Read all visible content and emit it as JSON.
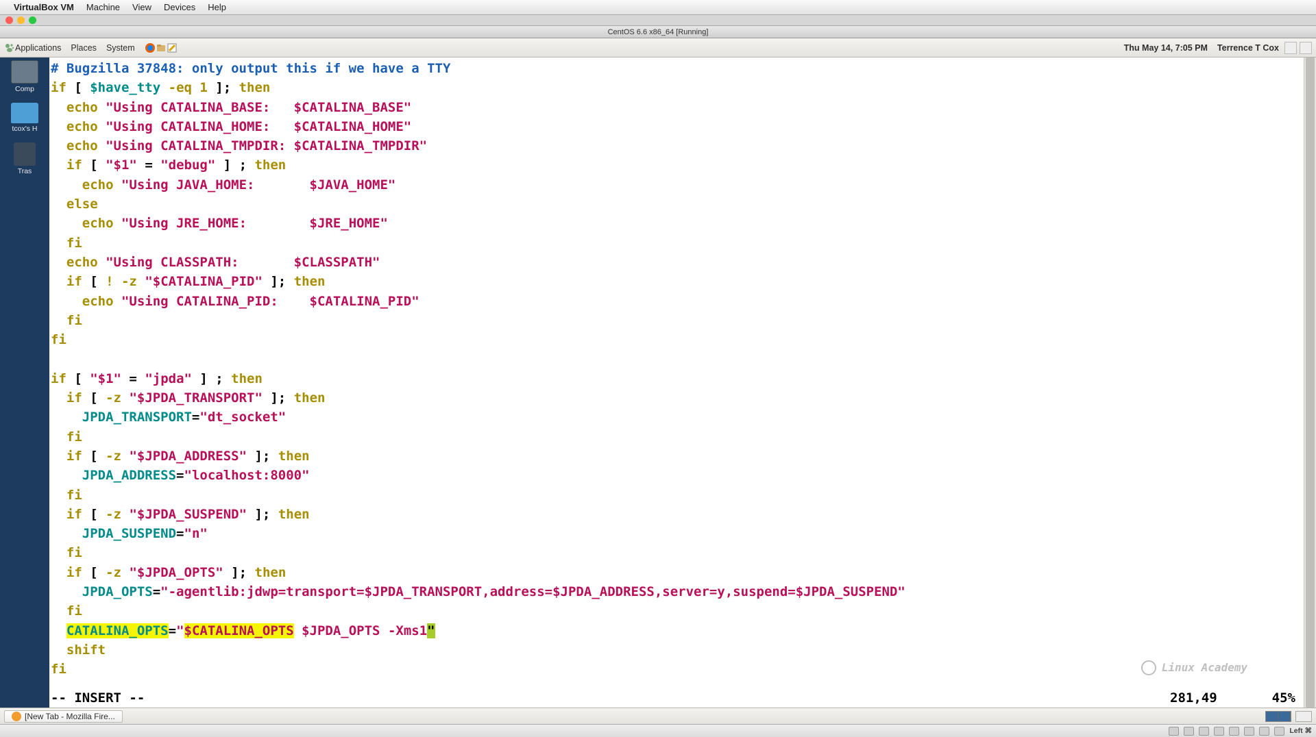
{
  "mac_menu": {
    "app": "VirtualBox VM",
    "items": [
      "Machine",
      "View",
      "Devices",
      "Help"
    ]
  },
  "vm_title": "CentOS 6.6 x86_64 [Running]",
  "gnome_top": {
    "menus": [
      "Applications",
      "Places",
      "System"
    ],
    "clock": "Thu May 14,  7:05 PM",
    "user": "Terrence T Cox"
  },
  "desktop_icons": {
    "computer": "Comp",
    "home": "tcox's H",
    "trash": "Tras"
  },
  "task_button": "[New Tab - Mozilla Fire...",
  "vb_hostkey": "Left ⌘",
  "watermark": "Linux Academy",
  "vim": {
    "mode": "-- INSERT --",
    "pos": "281,49",
    "pct": "45%",
    "code": {
      "l1_comment": "# Bugzilla 37848: only output this if we have a TTY",
      "have_tty": "$have_tty",
      "eq1": "-eq 1",
      "echo": "echo",
      "if": "if",
      "then": "then",
      "else": "else",
      "fi": "fi",
      "shift": "shift",
      "using_cb": "\"Using CATALINA_BASE:   $CATALINA_BASE\"",
      "using_ch": "\"Using CATALINA_HOME:   $CATALINA_HOME\"",
      "using_ct": "\"Using CATALINA_TMPDIR: $CATALINA_TMPDIR\"",
      "q1": "\"$1\"",
      "debug": "\"debug\"",
      "using_jh": "\"Using JAVA_HOME:       $JAVA_HOME\"",
      "using_jre": "\"Using JRE_HOME:        $JRE_HOME\"",
      "using_cp": "\"Using CLASSPATH:       $CLASSPATH\"",
      "catpid": "\"$CATALINA_PID\"",
      "using_cpid": "\"Using CATALINA_PID:    $CATALINA_PID\"",
      "jpda": "\"jpda\"",
      "jpda_t": "\"$JPDA_TRANSPORT\"",
      "jpda_t_var": "JPDA_TRANSPORT",
      "dtsock": "\"dt_socket\"",
      "jpda_a": "\"$JPDA_ADDRESS\"",
      "jpda_a_var": "JPDA_ADDRESS",
      "localhost": "\"localhost:8000\"",
      "jpda_s": "\"$JPDA_SUSPEND\"",
      "jpda_s_var": "JPDA_SUSPEND",
      "n": "\"n\"",
      "jpda_o": "\"$JPDA_OPTS\"",
      "jpda_o_var": "JPDA_OPTS",
      "agentlib": "\"-agentlib:jdwp=transport=$JPDA_TRANSPORT,address=$JPDA_ADDRESS,server=y,suspend=$JPDA_SUSPEND\"",
      "catopts_var": "CATALINA_OPTS",
      "catopts_hl": "$CATALINA_OPTS",
      "catopts_rest": " $JPDA_OPTS -Xms1",
      "bang_z": "! -z",
      "dash_z": "-z",
      "eqsign": "="
    }
  }
}
